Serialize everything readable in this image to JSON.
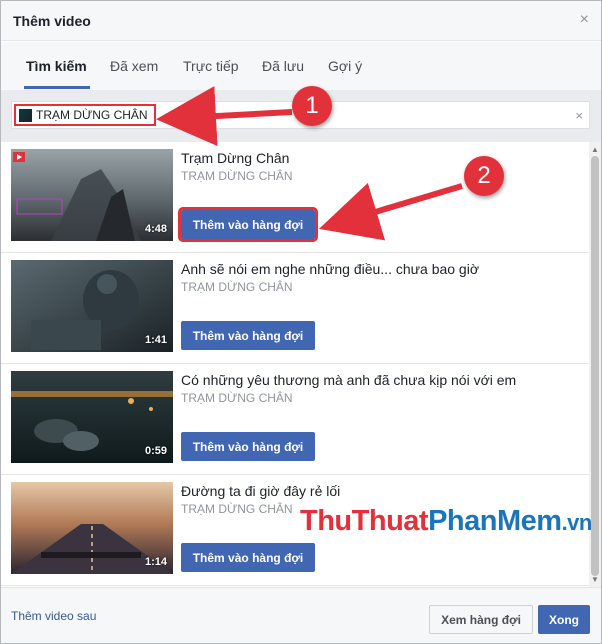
{
  "dialog": {
    "title": "Thêm video",
    "close_glyph": "×"
  },
  "tabs": [
    {
      "label": "Tìm kiếm",
      "active": true
    },
    {
      "label": "Đã xem",
      "active": false
    },
    {
      "label": "Trực tiếp",
      "active": false
    },
    {
      "label": "Đã lưu",
      "active": false
    },
    {
      "label": "Gợi ý",
      "active": false
    }
  ],
  "search": {
    "value": "TRẠM DỪNG CHÂN",
    "clear_glyph": "×"
  },
  "results": [
    {
      "title": "Trạm Dừng Chân",
      "channel": "TRẠM DỪNG CHÂN",
      "duration": "4:48",
      "button": "Thêm vào hàng đợi"
    },
    {
      "title": "Anh sẽ nói em nghe những điều... chưa bao giờ",
      "channel": "TRẠM DỪNG CHÂN",
      "duration": "1:41",
      "button": "Thêm vào hàng đợi"
    },
    {
      "title": "Có những yêu thương mà anh đã chưa kịp nói với em",
      "channel": "TRẠM DỪNG CHÂN",
      "duration": "0:59",
      "button": "Thêm vào hàng đợi"
    },
    {
      "title": "Đường ta đi giờ đây rẻ lối",
      "channel": "TRẠM DỪNG CHÂN",
      "duration": "1:14",
      "button": "Thêm vào hàng đợi"
    }
  ],
  "footer": {
    "add_later": "Thêm video sau",
    "view_queue": "Xem hàng đợi",
    "done": "Xong"
  },
  "annotations": {
    "step1": "1",
    "step2": "2",
    "color": "#e2313b"
  },
  "watermark": {
    "part1": "ThuThuat",
    "part2": "PhanMem",
    "part3": ".vn"
  },
  "colors": {
    "accent": "#4267b2",
    "link": "#365899",
    "muted": "#90949c"
  }
}
